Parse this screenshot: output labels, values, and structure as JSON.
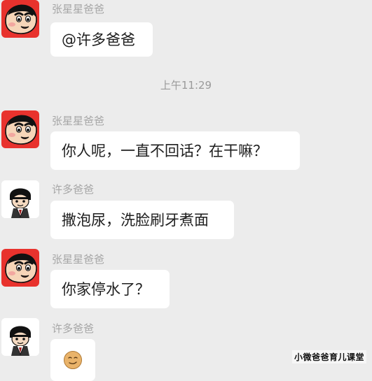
{
  "timestamp": "上午11:29",
  "messages": [
    {
      "sender": "张星星爸爸",
      "avatar": "crayon-shinchan-avatar",
      "text": "@许多爸爸"
    },
    {
      "sender": "张星星爸爸",
      "avatar": "crayon-shinchan-avatar",
      "text": "你人呢，一直不回话？在干嘛？"
    },
    {
      "sender": "许多爸爸",
      "avatar": "cartoon-bowl-cut-boy-avatar",
      "text": "撒泡尿，洗脸刷牙煮面"
    },
    {
      "sender": "张星星爸爸",
      "avatar": "crayon-shinchan-avatar",
      "text": "你家停水了？"
    },
    {
      "sender": "许多爸爸",
      "avatar": "cartoon-bowl-cut-boy-avatar",
      "text": "",
      "emoji": "smirk-face-emoji"
    }
  ],
  "watermark": "小微爸爸育儿课堂",
  "colors": {
    "background": "#ececec",
    "bubble": "#ffffff",
    "name_text": "#a6a6a6",
    "message_text": "#1e1e1e",
    "shinchan_bg": "#e8322d"
  }
}
